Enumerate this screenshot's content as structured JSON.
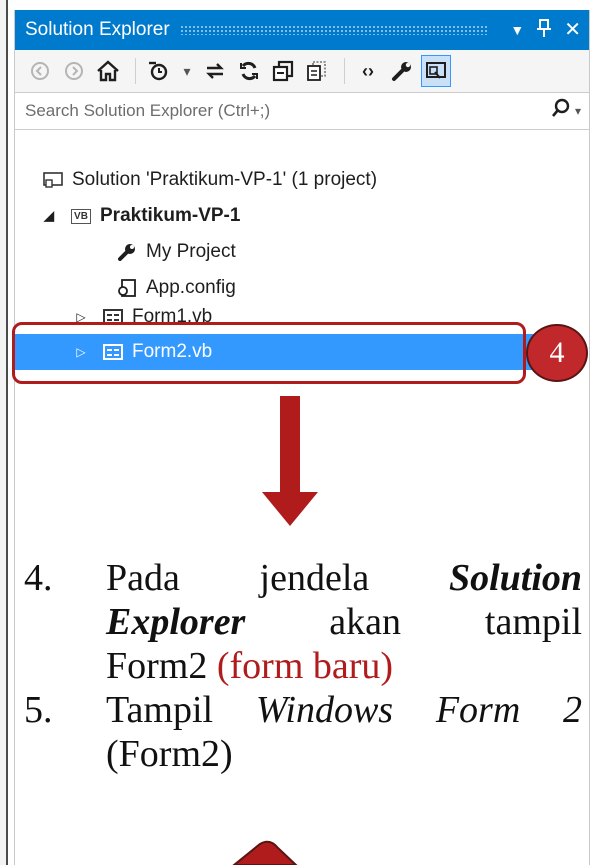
{
  "panel": {
    "title": "Solution Explorer",
    "controls": {
      "dropdown": "▼",
      "pin": "ᵽ",
      "close": "✕"
    }
  },
  "toolbar": {
    "buttons": [
      "back-icon",
      "forward-icon",
      "home-icon",
      "pending-changes-icon",
      "sync-icon",
      "refresh-icon",
      "collapse-all-icon",
      "show-all-files-icon",
      "view-code-icon",
      "properties-icon",
      "preview-selected-icon"
    ]
  },
  "search": {
    "placeholder": "Search Solution Explorer (Ctrl+;)"
  },
  "tree": {
    "solution": "Solution 'Praktikum-VP-1' (1 project)",
    "project": "Praktikum-VP-1",
    "vb_badge": "VB",
    "items": [
      "My Project",
      "App.config",
      "Form1.vb",
      "Form2.vb"
    ]
  },
  "annotation": {
    "step_number": "4",
    "box_color": "#b01c1c",
    "badge_color": "#c0282b"
  },
  "notes": {
    "item4_number": "4.",
    "item4_word1": "Pada",
    "item4_word2": "jendela",
    "item4_word3": "Solution",
    "item4_word4": "Explorer",
    "item4_word5": "akan",
    "item4_word6": "tampil",
    "item4_line3": "Form2",
    "item4_red": "(form baru)",
    "item5_number": "5.",
    "item5_word1": "Tampil",
    "item5_italic": "Windows Form 2",
    "item5_line2": "(Form2)"
  },
  "colors": {
    "accent": "#007acc",
    "selection": "#3399ff",
    "annotation_red": "#b01c1c"
  }
}
